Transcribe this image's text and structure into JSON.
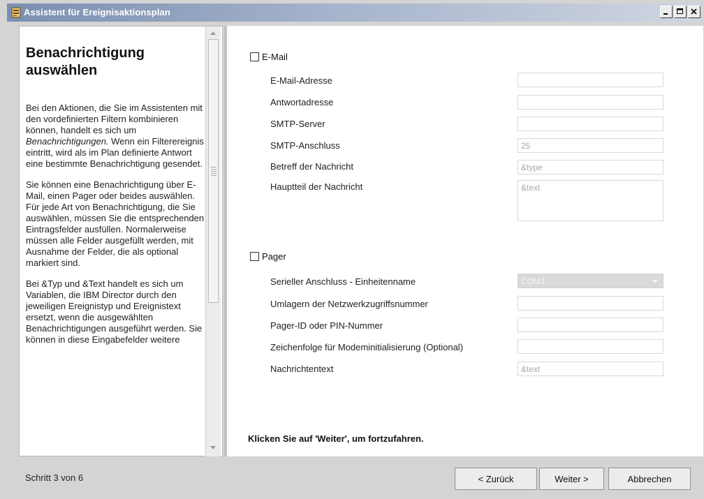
{
  "window": {
    "title": "Assistent für Ereignisaktionsplan",
    "controls": [
      "minimize-icon",
      "maximize-icon",
      "close-icon"
    ]
  },
  "help": {
    "title": "Benachrichtigung auswählen",
    "p1_before": "Bei den Aktionen, die Sie im Assistenten mit den vordefinierten Filtern kombinieren können, handelt es sich um ",
    "p1_em": "Benachrichtigungen.",
    "p1_after": " Wenn ein Filterereignis eintritt, wird als im Plan definierte Antwort eine bestimmte Benachrichtigung gesendet.",
    "p2": "Sie können eine Benachrichtigung über E-Mail, einen Pager oder beides auswählen. Für jede Art von Benachrichtigung, die Sie auswählen, müssen Sie die entsprechenden Eintragsfelder ausfüllen. Normalerweise müssen alle Felder ausgefüllt werden, mit Ausnahme der Felder, die als optional markiert sind.",
    "p3": "Bei &Typ und &Text handelt es sich um Variablen, die IBM Director durch den jeweiligen Ereignistyp und Ereignistext ersetzt, wenn die ausgewählten Benachrichtigungen ausgeführt werden. Sie können in diese Eingabefelder weitere"
  },
  "email": {
    "label": "E-Mail",
    "checked": false,
    "address_label": "E-Mail-Adresse",
    "address_value": "",
    "reply_label": "Antwortadresse",
    "reply_value": "",
    "smtp_server_label": "SMTP-Server",
    "smtp_server_value": "",
    "smtp_port_label": "SMTP-Anschluss",
    "smtp_port_value": "25",
    "subject_label": "Betreff der Nachricht",
    "subject_value": "&type",
    "body_label": "Hauptteil der Nachricht",
    "body_value": "&text"
  },
  "pager": {
    "label": "Pager",
    "checked": false,
    "serial_label": "Serieller Anschluss - Einheitenname",
    "serial_value": "COM1",
    "dialout_label": "Umlagern der Netzwerkzugriffsnummer",
    "dialout_value": "",
    "pin_label": "Pager-ID oder PIN-Nummer",
    "pin_value": "",
    "modem_label": "Zeichenfolge für Modeminitialisierung (Optional)",
    "modem_value": "",
    "message_label": "Nachrichtentext",
    "message_value": "&text"
  },
  "footer_message": "Klicken Sie auf 'Weiter', um fortzufahren.",
  "step": "Schritt 3 von 6",
  "buttons": {
    "back": "< Zurück",
    "next": "Weiter >",
    "cancel": "Abbrechen"
  },
  "colors": {
    "window_bg": "#d4d4d4",
    "panel_bg": "#ffffff",
    "title_gradient_start": "#7b8fb0",
    "disabled_text": "#a8a8a8"
  }
}
